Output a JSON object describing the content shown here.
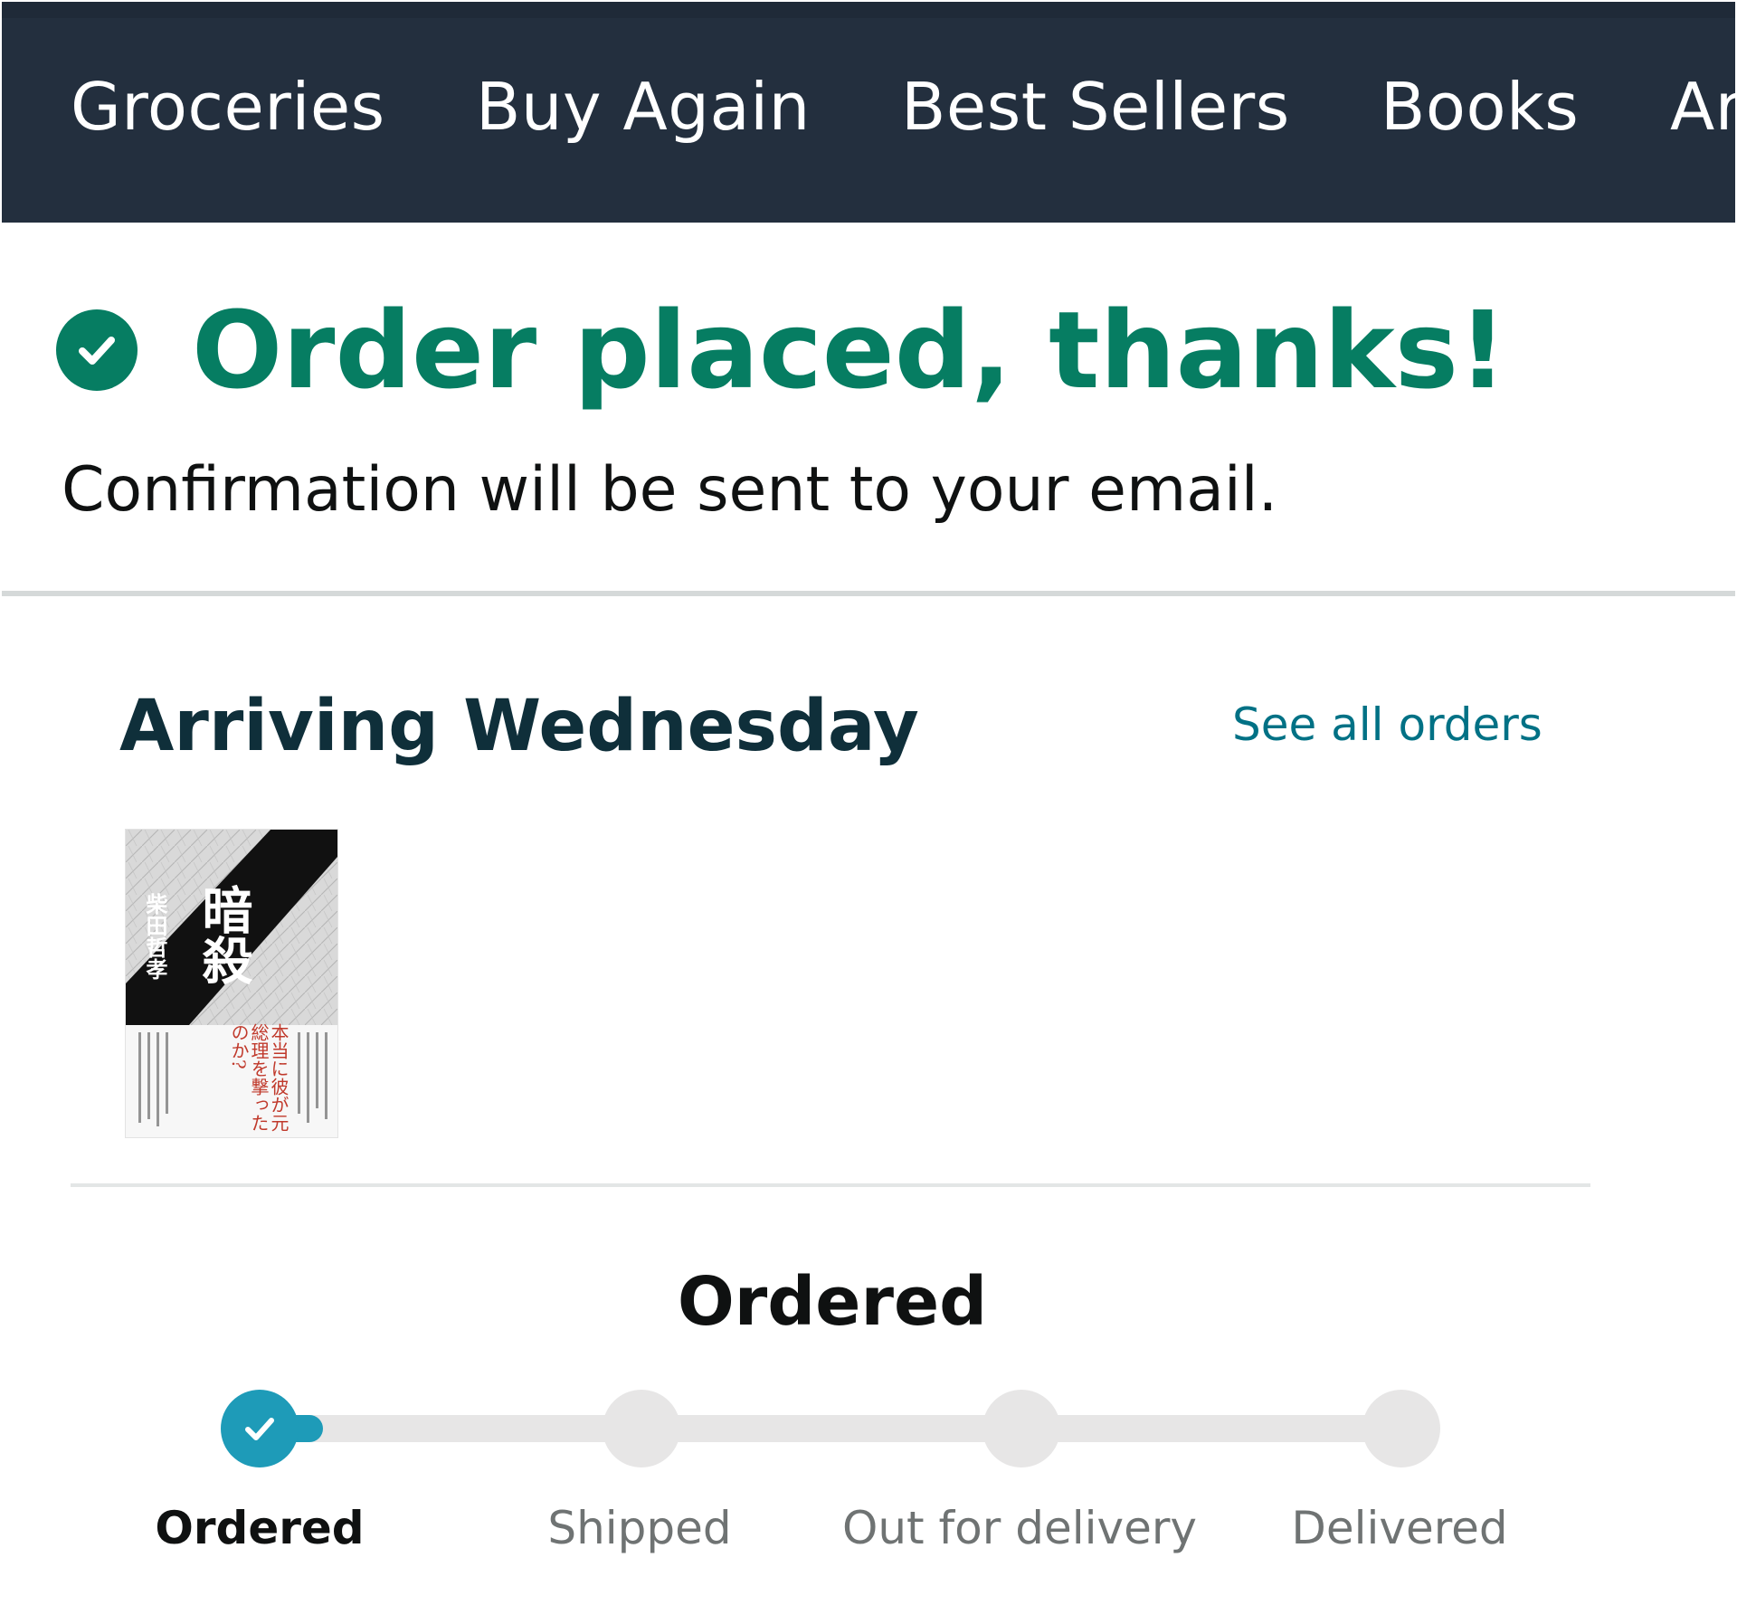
{
  "nav": {
    "items": [
      {
        "label": "Groceries"
      },
      {
        "label": "Buy Again"
      },
      {
        "label": "Best Sellers"
      },
      {
        "label": "Books"
      },
      {
        "label": "Ar"
      }
    ]
  },
  "confirmation": {
    "title": "Order placed, thanks!",
    "subtitle": "Confirmation will be sent to your email.",
    "icon": "check-circle-icon",
    "accent_color": "#067d62"
  },
  "shipment": {
    "arrival_label": "Arriving Wednesday",
    "see_all_label": "See all orders",
    "item": {
      "cover_title": "暗殺",
      "cover_author": "柴田哲孝",
      "cover_blurb": "本当に彼が元総理を撃ったのか?"
    }
  },
  "tracker": {
    "current_status": "Ordered",
    "progress_color": "#1e9bb8",
    "steps": [
      {
        "label": "Ordered",
        "done": true
      },
      {
        "label": "Shipped",
        "done": false
      },
      {
        "label": "Out for delivery",
        "done": false
      },
      {
        "label": "Delivered",
        "done": false
      }
    ]
  }
}
